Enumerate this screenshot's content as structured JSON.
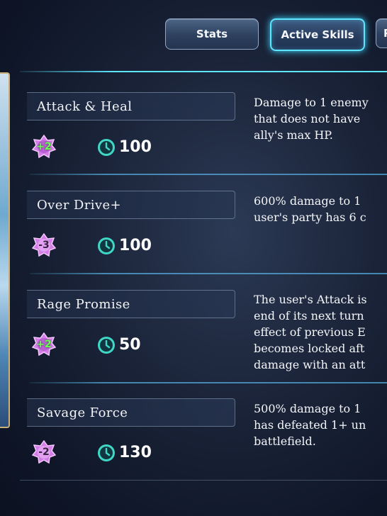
{
  "tabs": [
    {
      "label": "Stats",
      "active": false
    },
    {
      "label": "Active Skills",
      "active": true
    },
    {
      "label": "P",
      "active": false
    }
  ],
  "skills": [
    {
      "name": "Attack & Heal",
      "gem": "+2",
      "gem_type": "positive",
      "cooldown": "100",
      "description": [
        "Damage to 1 enemy",
        "that does not have",
        "ally's max HP."
      ]
    },
    {
      "name": "Over Drive+",
      "gem": "-3",
      "gem_type": "negative",
      "cooldown": "100",
      "description": [
        "600% damage to 1",
        "user's party has 6 c"
      ]
    },
    {
      "name": "Rage Promise",
      "gem": "+2",
      "gem_type": "positive",
      "cooldown": "50",
      "description": [
        "The user's Attack is",
        "end of its next turn",
        "effect of previous E",
        "becomes locked aft",
        "damage with an att"
      ]
    },
    {
      "name": "Savage Force",
      "gem": "-2",
      "gem_type": "negative",
      "cooldown": "130",
      "description": [
        "500% damage to 1",
        "has defeated 1+ un",
        "battlefield."
      ]
    }
  ],
  "colors": {
    "accent": "#5ee6ff",
    "gem_positive_text": "#6cff5a",
    "gem_fill": "#d27ee6",
    "clock": "#3fd8c6"
  },
  "icons": {
    "gem": "magic-gem-icon",
    "cooldown": "clock-icon"
  }
}
